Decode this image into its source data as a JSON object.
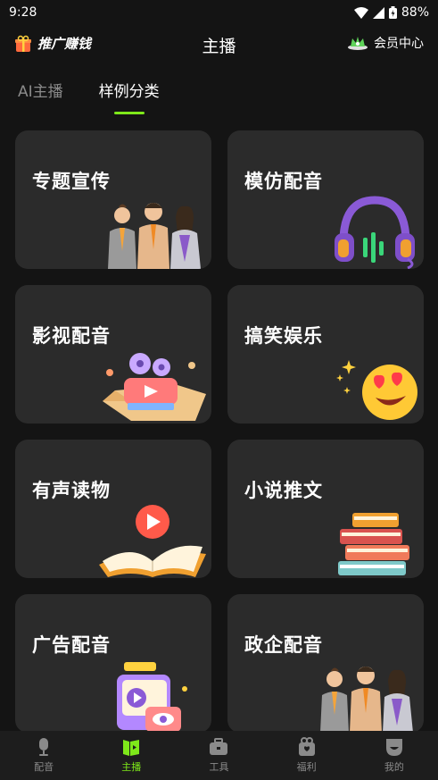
{
  "status": {
    "time": "9:28",
    "battery": "88%"
  },
  "header": {
    "promo_label": "推广赚钱",
    "title": "主播",
    "vip_label": "会员中心"
  },
  "tabs": [
    {
      "label": "AI主播",
      "active": false
    },
    {
      "label": "样例分类",
      "active": true
    }
  ],
  "categories": [
    {
      "title": "专题宣传",
      "art": "people-icon"
    },
    {
      "title": "模仿配音",
      "art": "headphones-icon"
    },
    {
      "title": "影视配音",
      "art": "film-projector-icon"
    },
    {
      "title": "搞笑娱乐",
      "art": "heart-eyes-emoji-icon"
    },
    {
      "title": "有声读物",
      "art": "open-book-play-icon"
    },
    {
      "title": "小说推文",
      "art": "book-stack-icon"
    },
    {
      "title": "广告配音",
      "art": "video-ad-icon"
    },
    {
      "title": "政企配音",
      "art": "people-icon"
    }
  ],
  "bottom_nav": [
    {
      "label": "配音",
      "icon": "microphone-icon",
      "active": false
    },
    {
      "label": "主播",
      "icon": "anchor-icon",
      "active": true
    },
    {
      "label": "工具",
      "icon": "toolbox-icon",
      "active": false
    },
    {
      "label": "福利",
      "icon": "gift-icon",
      "active": false
    },
    {
      "label": "我的",
      "icon": "profile-icon",
      "active": false
    }
  ],
  "colors": {
    "accent": "#7ee81a",
    "background": "#141414",
    "card": "#2b2b2b"
  }
}
